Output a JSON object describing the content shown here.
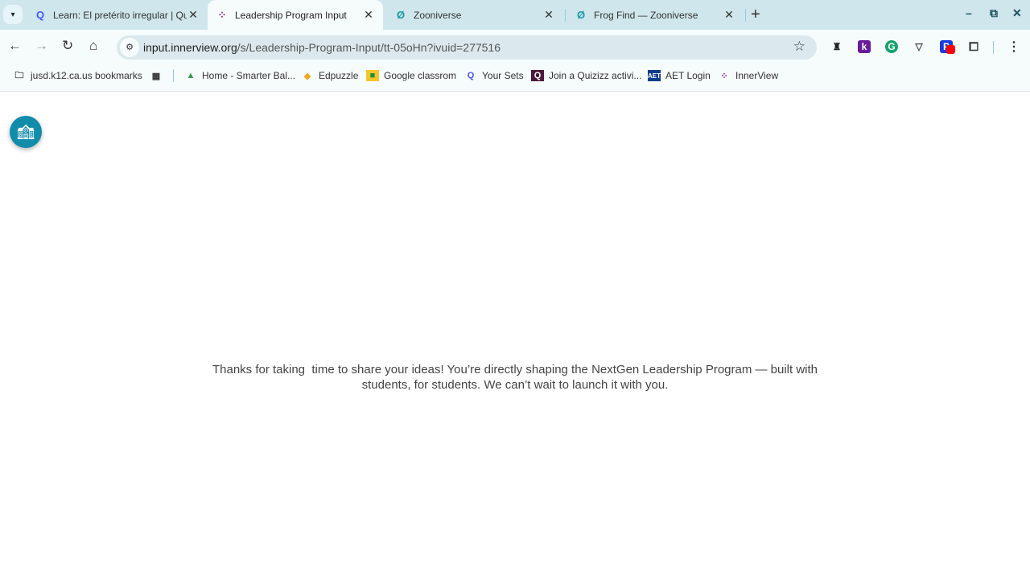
{
  "browser": {
    "tabs": [
      {
        "title": "Learn: El pretérito irregular | Qu",
        "icon": "quizlet-icon",
        "active": false
      },
      {
        "title": "Leadership Program Input",
        "icon": "innerview-icon",
        "active": true
      },
      {
        "title": "Zooniverse",
        "icon": "zooniverse-icon",
        "active": false
      },
      {
        "title": "Frog Find — Zooniverse",
        "icon": "zooniverse-icon",
        "active": false
      }
    ],
    "url_host": "input.innerview.org",
    "url_path": "/s/Leadership-Program-Input/tt-05oHn?ivuid=277516",
    "bookmarks": [
      {
        "label": "jusd.k12.ca.us bookmarks",
        "icon": "managed-folder-icon"
      },
      {
        "label": "Home - Smarter Bal...",
        "icon": "smarter-balanced-icon"
      },
      {
        "label": "Edpuzzle",
        "icon": "edpuzzle-icon"
      },
      {
        "label": "Google classrom",
        "icon": "google-classroom-icon"
      },
      {
        "label": "Your Sets",
        "icon": "quizlet-icon"
      },
      {
        "label": "Join a Quizizz activi...",
        "icon": "quizizz-icon"
      },
      {
        "label": "AET Login",
        "icon": "aet-icon"
      },
      {
        "label": "InnerView",
        "icon": "innerview-icon"
      }
    ],
    "colors": {
      "tabstrip": "#cfe6ec",
      "toolbar": "#f6fbfc",
      "omnibox": "#dbe9ee",
      "accent": "#118cab"
    }
  },
  "page": {
    "message": "Thanks for taking  time to share your ideas! You’re directly shaping the NextGen Leadership Program — built with students, for students. We can’t wait to launch it with you."
  }
}
